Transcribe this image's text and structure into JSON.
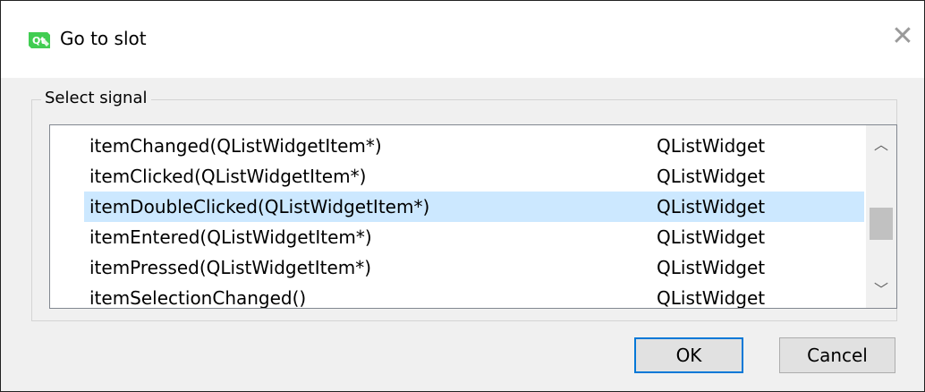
{
  "window": {
    "title": "Go to slot",
    "icon": "qt-designer-icon",
    "close_glyph": "✕"
  },
  "group": {
    "label": "Select signal"
  },
  "signals": [
    {
      "signal": "itemChanged(QListWidgetItem*)",
      "class": "QListWidget",
      "selected": false
    },
    {
      "signal": "itemClicked(QListWidgetItem*)",
      "class": "QListWidget",
      "selected": false
    },
    {
      "signal": "itemDoubleClicked(QListWidgetItem*)",
      "class": "QListWidget",
      "selected": true
    },
    {
      "signal": "itemEntered(QListWidgetItem*)",
      "class": "QListWidget",
      "selected": false
    },
    {
      "signal": "itemPressed(QListWidgetItem*)",
      "class": "QListWidget",
      "selected": false
    },
    {
      "signal": "itemSelectionChanged()",
      "class": "QListWidget",
      "selected": false
    }
  ],
  "scrollbar": {
    "up_glyph": "︿",
    "down_glyph": "﹀"
  },
  "buttons": {
    "ok": "OK",
    "cancel": "Cancel"
  },
  "colors": {
    "selection": "#cce8ff",
    "default_button_border": "#0078d7",
    "qt_green": "#41cd52"
  }
}
